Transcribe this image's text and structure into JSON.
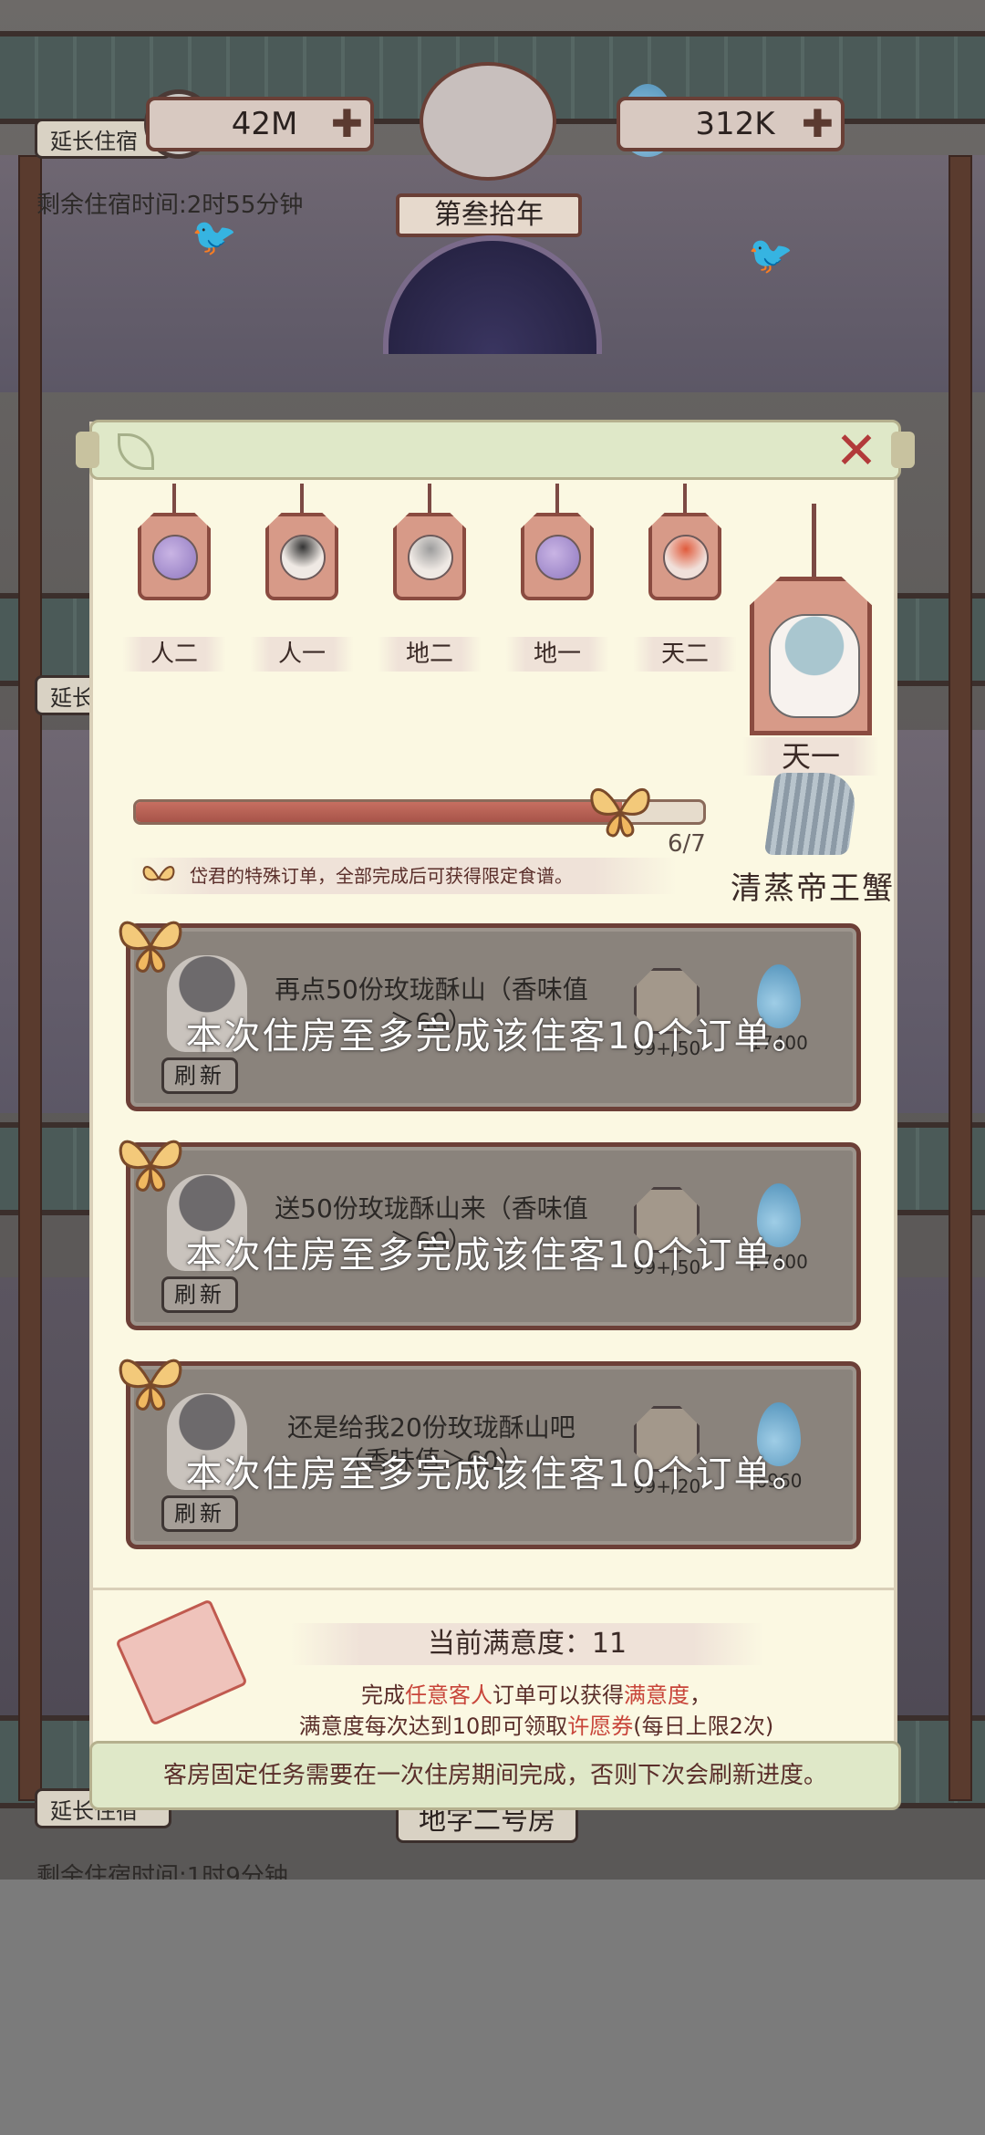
{
  "hud": {
    "coins": "42M",
    "drops": "312K",
    "year": "第叁拾年",
    "extend_stay": "延长住宿",
    "remaining_top": "剩余住宿时间:2时55分钟",
    "remaining_bottom": "剩余住宿时间:1时9分钟",
    "room_name": "地字二号房"
  },
  "panel": {
    "guests": [
      {
        "label": "人二",
        "face": "purple"
      },
      {
        "label": "人一",
        "face": "dark"
      },
      {
        "label": "地二",
        "face": "grey"
      },
      {
        "label": "地一",
        "face": "purple"
      },
      {
        "label": "天二",
        "face": "red"
      }
    ],
    "featured_guest": "天一",
    "progress": {
      "current": 6,
      "total": 7,
      "text": "6/7"
    },
    "dish_name": "清蒸帝王蟹",
    "hint": "岱君的特殊订单，全部完成后可获得限定食谱。",
    "orders": [
      {
        "text": "再点50份玫珑酥山（香味值＞60）",
        "reward_a": "99+/50",
        "reward_b": "17400",
        "refresh": "刷新",
        "overlay": "本次住房至多完成该住客10个订单。"
      },
      {
        "text": "送50份玫珑酥山来（香味值＞60）",
        "reward_a": "99+/50",
        "reward_b": "17400",
        "refresh": "刷新",
        "overlay": "本次住房至多完成该住客10个订单。"
      },
      {
        "text": "还是给我20份玫珑酥山吧（香味值＞60）",
        "reward_a": "99+/20",
        "reward_b": "6960",
        "refresh": "刷新",
        "overlay": "本次住房至多完成该住客10个订单。"
      }
    ],
    "satisfaction": {
      "title": "当前满意度：11",
      "line1_pre": "完成",
      "line1_hl1": "任意客人",
      "line1_mid": "订单可以获得",
      "line1_hl2": "满意度",
      "line1_post": "，",
      "line2_pre": "满意度每次达到10即可领取",
      "line2_hl": "许愿券",
      "line2_post": "(每日上限2次)"
    },
    "footer": "客房固定任务需要在一次住房期间完成，否则下次会刷新进度。"
  },
  "colors": {
    "accent_red": "#c8453a",
    "panel_bg": "#fbf8e2",
    "progress": "#a75449"
  }
}
